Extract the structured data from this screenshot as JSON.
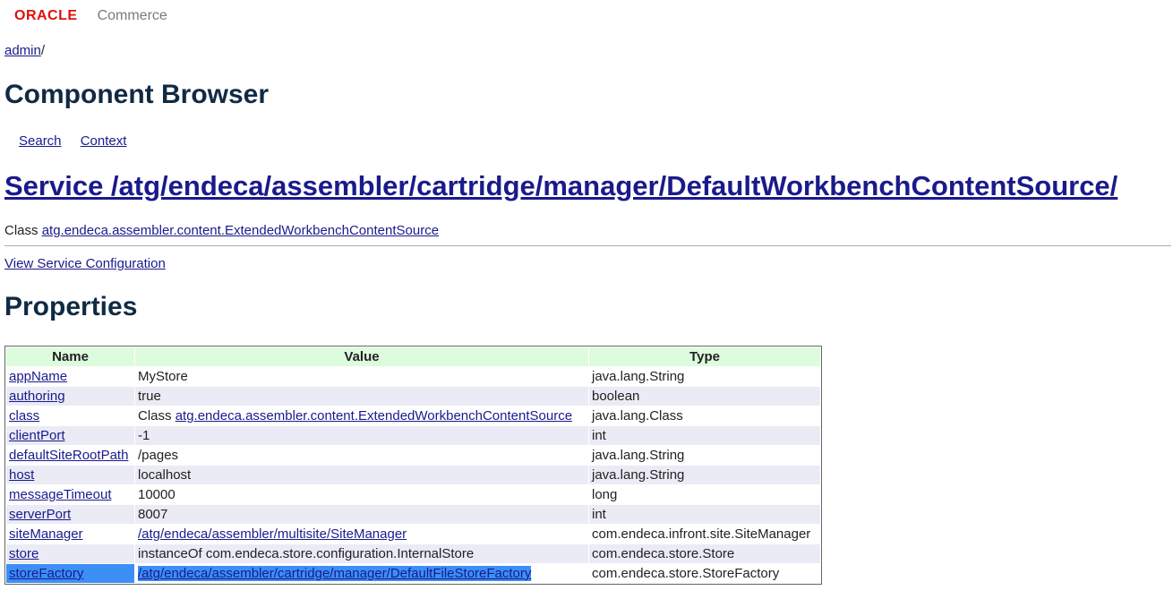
{
  "header": {
    "logo": "ORACLE",
    "product": "Commerce"
  },
  "breadcrumb": {
    "link": "admin",
    "sep": "/"
  },
  "page_title": "Component Browser",
  "subnav": {
    "search": "Search",
    "context": "Context"
  },
  "service": {
    "title": "Service /atg/endeca/assembler/cartridge/manager/DefaultWorkbenchContentSource/"
  },
  "class_line": {
    "prefix": "Class",
    "link": "atg.endeca.assembler.content.ExtendedWorkbenchContentSource"
  },
  "view_config": "View Service Configuration",
  "properties_heading": "Properties",
  "table": {
    "headers": {
      "name": "Name",
      "value": "Value",
      "type": "Type"
    },
    "rows": [
      {
        "name": "appName",
        "value_prefix": "",
        "value": "MyStore",
        "value_link": "",
        "type": "java.lang.String"
      },
      {
        "name": "authoring",
        "value_prefix": "",
        "value": "true",
        "value_link": "",
        "type": "boolean"
      },
      {
        "name": "class",
        "value_prefix": "Class ",
        "value": "",
        "value_link": "atg.endeca.assembler.content.ExtendedWorkbenchContentSource",
        "type": "java.lang.Class"
      },
      {
        "name": "clientPort",
        "value_prefix": "",
        "value": "-1",
        "value_link": "",
        "type": "int"
      },
      {
        "name": "defaultSiteRootPath",
        "value_prefix": "",
        "value": "/pages",
        "value_link": "",
        "type": "java.lang.String"
      },
      {
        "name": "host",
        "value_prefix": "",
        "value": "localhost",
        "value_link": "",
        "type": "java.lang.String"
      },
      {
        "name": "messageTimeout",
        "value_prefix": "",
        "value": "10000",
        "value_link": "",
        "type": "long"
      },
      {
        "name": "serverPort",
        "value_prefix": "",
        "value": "8007",
        "value_link": "",
        "type": "int"
      },
      {
        "name": "siteManager",
        "value_prefix": "",
        "value": "",
        "value_link": "/atg/endeca/assembler/multisite/SiteManager",
        "type": "com.endeca.infront.site.SiteManager"
      },
      {
        "name": "store",
        "value_prefix": "",
        "value": "instanceOf com.endeca.store.configuration.InternalStore",
        "value_link": "",
        "type": "com.endeca.store.Store"
      },
      {
        "name": "storeFactory",
        "value_prefix": "",
        "value": "",
        "value_link": "/atg/endeca/assembler/cartridge/manager/DefaultFileStoreFactory",
        "type": "com.endeca.store.StoreFactory"
      }
    ]
  },
  "colors": {
    "logo": "#e20e0e",
    "link": "#1a1a8c",
    "heading": "#102a43",
    "header_bg": "#ddfbdd",
    "row_alt": "#ebebf6",
    "selection": "#3b8ff6"
  }
}
